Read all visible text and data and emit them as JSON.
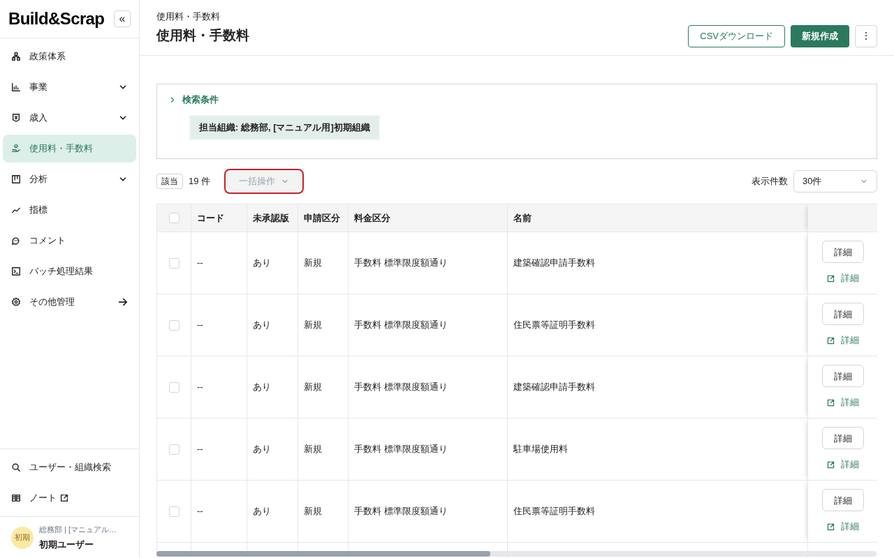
{
  "sidebar": {
    "logo": "Build&Scrap",
    "collapse": "«",
    "items": [
      {
        "label": "政策体系",
        "kind": "plain",
        "selected": false
      },
      {
        "label": "事業",
        "kind": "expandable",
        "selected": false
      },
      {
        "label": "歳入",
        "kind": "expandable",
        "selected": false
      },
      {
        "label": "使用料・手数料",
        "kind": "plain",
        "selected": true
      },
      {
        "label": "分析",
        "kind": "expandable",
        "selected": false
      },
      {
        "label": "指標",
        "kind": "plain",
        "selected": false
      },
      {
        "label": "コメント",
        "kind": "plain",
        "selected": false
      },
      {
        "label": "バッチ処理結果",
        "kind": "plain",
        "selected": false
      },
      {
        "label": "その他管理",
        "kind": "forward",
        "selected": false
      }
    ],
    "bottom_items": [
      {
        "label": "ユーザー・組織検索",
        "external": false
      },
      {
        "label": "ノート",
        "external": true
      }
    ],
    "user": {
      "avatar": "初期",
      "org": "総務部 | [マニュアル…",
      "name": "初期ユーザー"
    }
  },
  "header": {
    "breadcrumb": "使用料・手数料",
    "title": "使用料・手数料",
    "buttons": [
      "CSVダウンロード",
      "新規作成"
    ],
    "more": "⋮"
  },
  "search": {
    "label": "検索条件",
    "expanded": false,
    "chip": "担当組織: 総務部, [マニュアル用]初期組織"
  },
  "toolbar": {
    "badge": "該当",
    "count": "19 件",
    "bulk": "一括操作",
    "bulk_disabled": true,
    "page_size_label": "表示件数",
    "page_size": "30件"
  },
  "table": {
    "all_checked": false,
    "columns": [
      "コード",
      "未承認版",
      "申請区分",
      "料金区分",
      "名前"
    ],
    "rows": [
      {
        "checked": false,
        "cells": [
          "--",
          "あり",
          "新規",
          "手数料 標準限度額通り",
          "建築確認申請手数料"
        ],
        "button": "詳細",
        "link": "詳細"
      },
      {
        "checked": false,
        "cells": [
          "--",
          "あり",
          "新規",
          "手数料 標準限度額通り",
          "住民票等証明手数料"
        ],
        "button": "詳細",
        "link": "詳細"
      },
      {
        "checked": false,
        "cells": [
          "--",
          "あり",
          "新規",
          "手数料 標準限度額通り",
          "建築確認申請手数料"
        ],
        "button": "詳細",
        "link": "詳細"
      },
      {
        "checked": false,
        "cells": [
          "--",
          "あり",
          "新規",
          "手数料 標準限度額通り",
          "駐車場使用料"
        ],
        "button": "詳細",
        "link": "詳細"
      },
      {
        "checked": false,
        "cells": [
          "--",
          "あり",
          "新規",
          "手数料 標準限度額通り",
          "住民票等証明手数料"
        ],
        "button": "詳細",
        "link": "詳細"
      }
    ]
  }
}
